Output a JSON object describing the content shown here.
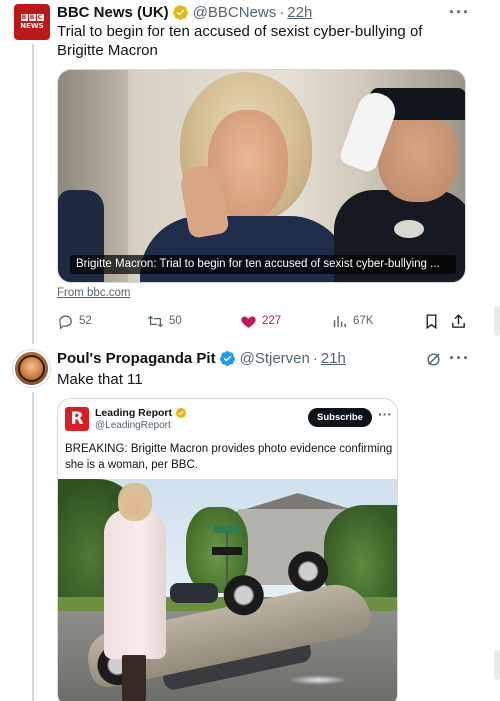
{
  "tweet1": {
    "avatar_label": "BBC NEWS",
    "avatar_letters": [
      "B",
      "B",
      "C"
    ],
    "avatar_word": "NEWS",
    "name": "BBC News (UK)",
    "handle": "@BBCNews",
    "separator": "·",
    "time": "22h",
    "more": "···",
    "text": "Trial to begin for ten accused of sexist cyber-bullying of Brigitte Macron",
    "media_caption": "Brigitte Macron: Trial to begin for ten accused of sexist cyber-bullying ...",
    "from_link": "From bbc.com",
    "replies": "52",
    "reposts": "50",
    "likes": "227",
    "views": "67K",
    "liked_color": "#be185d"
  },
  "tweet2": {
    "name": "Poul's Propaganda Pit",
    "handle": "@Stjerven",
    "separator": "·",
    "time": "21h",
    "more": "···",
    "text": "Make that 11",
    "quote": {
      "logo_letter": "R",
      "name": "Leading Report",
      "handle": "@LeadingReport",
      "subscribe_label": "Subscribe",
      "more": "···",
      "text": "BREAKING: Brigitte Macron provides photo evidence confirming she is a woman, per BBC."
    }
  },
  "colors": {
    "verified_gold": "#e2b719",
    "verified_blue": "#1d9bf0",
    "text_primary": "#0f1419",
    "text_secondary": "#536471",
    "bbc_red": "#bb1919",
    "leading_report_red": "#d91f26"
  }
}
